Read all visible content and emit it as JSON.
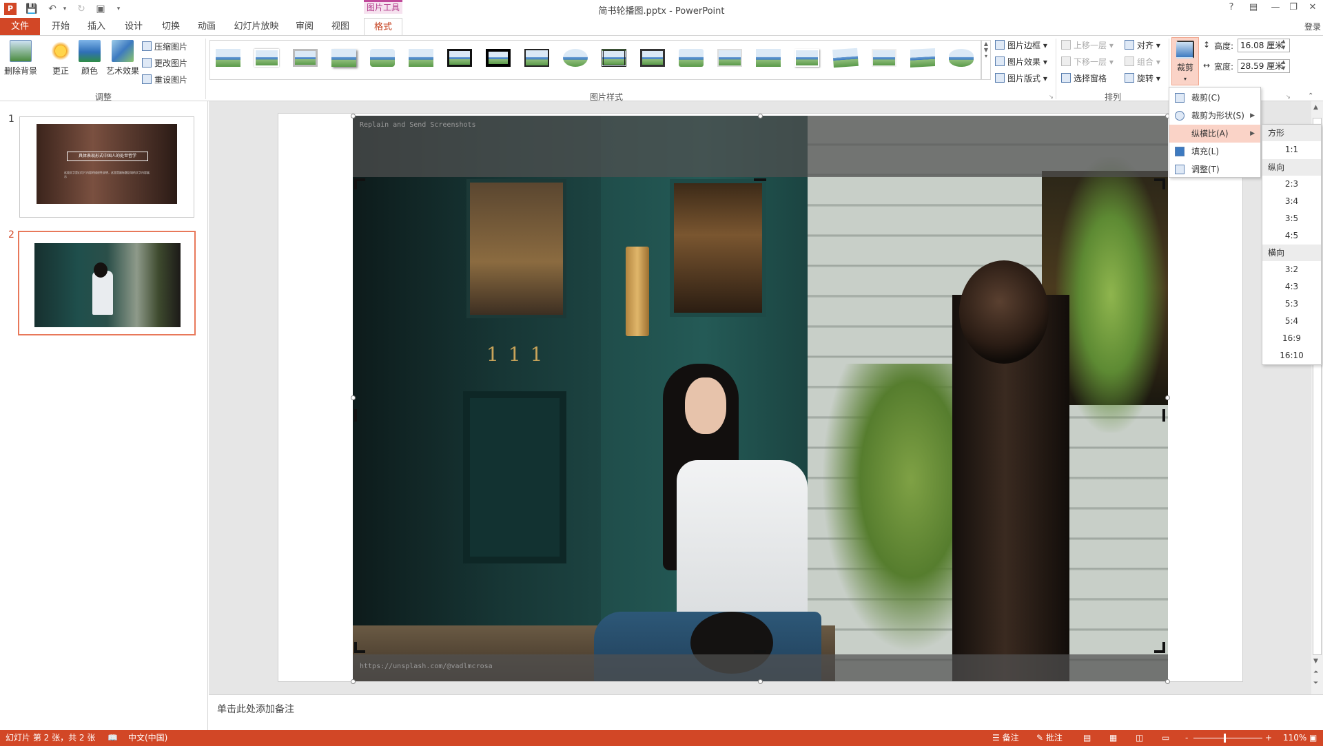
{
  "window": {
    "title": "简书轮播图.pptx - PowerPoint",
    "help": "?",
    "login": "登录"
  },
  "tabs": {
    "context_group": "图片工具",
    "items": [
      "文件",
      "开始",
      "插入",
      "设计",
      "切换",
      "动画",
      "幻灯片放映",
      "审阅",
      "视图",
      "格式"
    ]
  },
  "ribbon": {
    "adjust": {
      "remove_bg": "删除背景",
      "correct": "更正",
      "color": "颜色",
      "artistic": "艺术效果",
      "compress": "压缩图片",
      "change": "更改图片",
      "reset": "重设图片",
      "group_label": "调整"
    },
    "styles": {
      "group_label": "图片样式",
      "border": "图片边框",
      "effects": "图片效果",
      "layout": "图片版式"
    },
    "arrange": {
      "group_label": "排列",
      "bring_forward": "上移一层",
      "send_backward": "下移一层",
      "selection_pane": "选择窗格",
      "align": "对齐",
      "group": "组合",
      "rotate": "旋转"
    },
    "size": {
      "crop": "裁剪",
      "height_label": "高度:",
      "height_value": "16.08 厘米",
      "width_label": "宽度:",
      "width_value": "28.59 厘米"
    }
  },
  "slides": [
    {
      "number": "1",
      "title_text": "具体表现形式中国人的处世哲学",
      "body_text": "这段文字是幻灯片内容的描述性说明，这里是副标题区域的文字内容展示"
    },
    {
      "number": "2"
    }
  ],
  "photo": {
    "watermark_top": "Replain and Send Screenshots",
    "watermark_bottom": "https://unsplash.com/@vadlmcrosa"
  },
  "notes": {
    "placeholder": "单击此处添加备注"
  },
  "crop_menu": {
    "items": [
      "裁剪(C)",
      "裁剪为形状(S)",
      "纵横比(A)",
      "填充(L)",
      "调整(T)"
    ]
  },
  "aspect_menu": {
    "square_header": "方形",
    "square": [
      "1:1"
    ],
    "portrait_header": "纵向",
    "portrait": [
      "2:3",
      "3:4",
      "3:5",
      "4:5"
    ],
    "landscape_header": "横向",
    "landscape": [
      "3:2",
      "4:3",
      "5:3",
      "5:4",
      "16:9",
      "16:10"
    ]
  },
  "status": {
    "slide_info": "幻灯片 第 2 张，共 2 张",
    "language": "中文(中国)",
    "notes": "备注",
    "comments": "批注",
    "zoom": "110%",
    "minus": "-",
    "plus": "+"
  },
  "colors": {
    "accent": "#d24726",
    "context_tab": "#c0499a",
    "door_teal": "#1d4a48"
  }
}
